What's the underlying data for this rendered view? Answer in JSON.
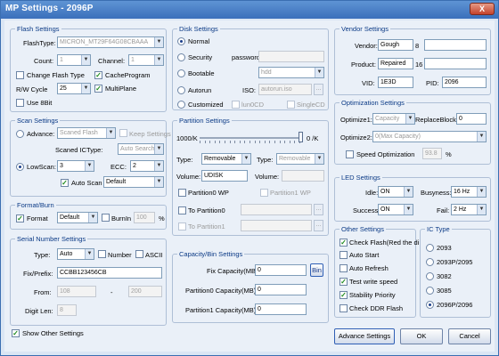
{
  "window": {
    "title": "MP Settings - 2096P",
    "close_label": "X"
  },
  "flash": {
    "legend": "Flash Settings",
    "flashtype_label": "FlashType:",
    "flashtype_value": "MICRON_MT29F64G08CBAAA",
    "count_label": "Count:",
    "count_value": "1",
    "channel_label": "Channel:",
    "channel_value": "1",
    "change_flash_type": "Change Flash Type",
    "cacheprogram": "CacheProgram",
    "rw_cycle_label": "R/W Cycle",
    "rw_cycle_value": "25",
    "multiplane": "MultiPlane",
    "use_8bit": "Use 8Bit"
  },
  "scan": {
    "legend": "Scan Settings",
    "advance_label": "Advance:",
    "advance_value": "Scaned Flash",
    "keep_settings": "Keep Settings",
    "scaned_ictype_label": "Scaned ICType:",
    "scaned_ictype_value": "Auto Search",
    "lowscan_label": "LowScan:",
    "lowscan_value": "3",
    "ecc_label": "ECC:",
    "ecc_value": "2",
    "auto_scan": "Auto Scan",
    "auto_scan_value": "Default"
  },
  "format": {
    "legend": "Format/Burn",
    "format_label": "Format",
    "format_value": "Default",
    "burnin_label": "BurnIn",
    "burnin_value": "100",
    "pct": "%"
  },
  "serial": {
    "legend": "Serial Number Settings",
    "type_label": "Type:",
    "type_value": "Auto",
    "number_label": "Number",
    "ascii_label": "ASCII",
    "fix_prefix_label": "Fix/Prefix:",
    "fix_prefix_value": "CCBB123456CB",
    "from_label": "From:",
    "from_value": "108",
    "dash": "-",
    "to_value": "200",
    "digit_len_label": "Digit Len:",
    "digit_len_value": "8"
  },
  "disk": {
    "legend": "Disk Settings",
    "normal": "Normal",
    "security": "Security",
    "password_label": "password:",
    "bootable": "Bootable",
    "bootable_value": "hdd",
    "autorun": "Autorun",
    "iso_label": "ISO:",
    "iso_value": "autorun.iso",
    "browse": "...",
    "customized": "Customized",
    "lun0cd": "lun0CD",
    "singlecd": "SingleCD"
  },
  "partition": {
    "legend": "Partition Settings",
    "ratio_left": "1000/K",
    "ratio_right": "0 /K",
    "type_label": "Type:",
    "type_value": "Removable",
    "type2_label": "Type:",
    "type2_value": "Removable",
    "volume_label": "Volume:",
    "volume_value": "UDISK",
    "volume2_label": "Volume:",
    "partition0_wp": "Partition0 WP",
    "partition1_wp": "Partition1 WP",
    "to_partition0": "To Partition0",
    "to_partition1": "To Partition1",
    "browse": "..."
  },
  "capacity": {
    "legend": "Capacity/Bin Settings",
    "fix_label": "Fix Capacity(MB):",
    "fix_value": "0",
    "bin_label": "Bin",
    "p0_label": "Partition0 Capacity(MB):",
    "p0_value": "0",
    "p1_label": "Partition1 Capacity(MB):",
    "p1_value": "0"
  },
  "vendor": {
    "legend": "Vendor Settings",
    "vendor_label": "Vendor:",
    "vendor_value": "Gough",
    "vendor_num": "8",
    "product_label": "Product:",
    "product_value": "Repaired",
    "product_num": "16",
    "vid_label": "VID:",
    "vid_value": "1E3D",
    "pid_label": "PID:",
    "pid_value": "2096"
  },
  "optimization": {
    "legend": "Optimization Settings",
    "optimize1_label": "Optimize1:",
    "optimize1_value": "Capacity",
    "replace_block_label": "ReplaceBlock:",
    "replace_block_value": "0",
    "optimize2_label": "Optimize2:",
    "optimize2_value": "0(Max Capacity)",
    "speed_opt": "Speed Optimization",
    "speed_value": "93.8",
    "pct": "%"
  },
  "led": {
    "legend": "LED Settings",
    "idle_label": "Idle:",
    "idle_value": "ON",
    "busyness_label": "Busyness:",
    "busyness_value": "16 Hz",
    "success_label": "Success:",
    "success_value": "ON",
    "fail_label": "Fail:",
    "fail_value": "2 Hz"
  },
  "other": {
    "legend": "Other Settings",
    "items": [
      "Check Flash(Red the di",
      "Auto Start",
      "Auto Refresh",
      "Test write speed",
      "Stability Priority",
      "Check DDR Flash"
    ]
  },
  "ictype": {
    "legend": "IC Type",
    "items": [
      "2093",
      "2093P/2095",
      "3082",
      "3085",
      "2096P/2096"
    ]
  },
  "footer": {
    "show_other": "Show Other Settings",
    "advance_settings": "Advance Settings",
    "ok": "OK",
    "cancel": "Cancel"
  },
  "colors": {
    "accent": "#3a6fbb",
    "group_label": "#0b3a86",
    "panel": "#eaf0f8"
  }
}
